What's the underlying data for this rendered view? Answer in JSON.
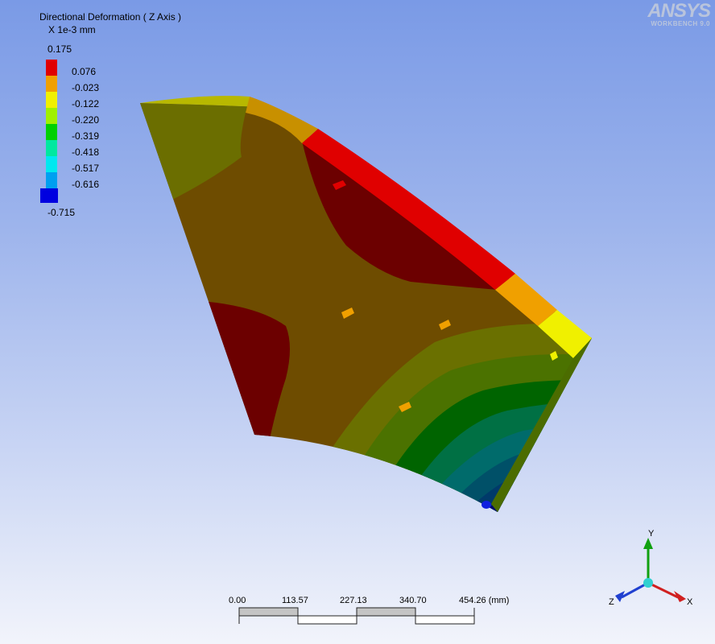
{
  "legend": {
    "title": "Directional Deformation ( Z Axis )",
    "units": "X 1e-3 mm",
    "max": "0.175",
    "min": "-0.715",
    "levels": [
      {
        "label": "0.076",
        "color": "#e00000"
      },
      {
        "label": "-0.023",
        "color": "#f0a000"
      },
      {
        "label": "-0.122",
        "color": "#f0f000"
      },
      {
        "label": "-0.220",
        "color": "#a0f000"
      },
      {
        "label": "-0.319",
        "color": "#00d000"
      },
      {
        "label": "-0.418",
        "color": "#00e8a0"
      },
      {
        "label": "-0.517",
        "color": "#00e8f0"
      },
      {
        "label": "-0.616",
        "color": "#00a0f0"
      },
      {
        "label": "",
        "color": "#0000e0"
      }
    ]
  },
  "brand": {
    "logo": "ANSYS",
    "subtitle": "WORKBENCH 9.0"
  },
  "scale": {
    "labels": [
      "0.00",
      "113.57",
      "227.13",
      "340.70",
      "454.26 (mm)"
    ]
  },
  "triad": {
    "y": "Y",
    "x": "X",
    "z": "Z",
    "colors": {
      "x": "#d02020",
      "y": "#10a010",
      "z": "#2040d0"
    }
  }
}
